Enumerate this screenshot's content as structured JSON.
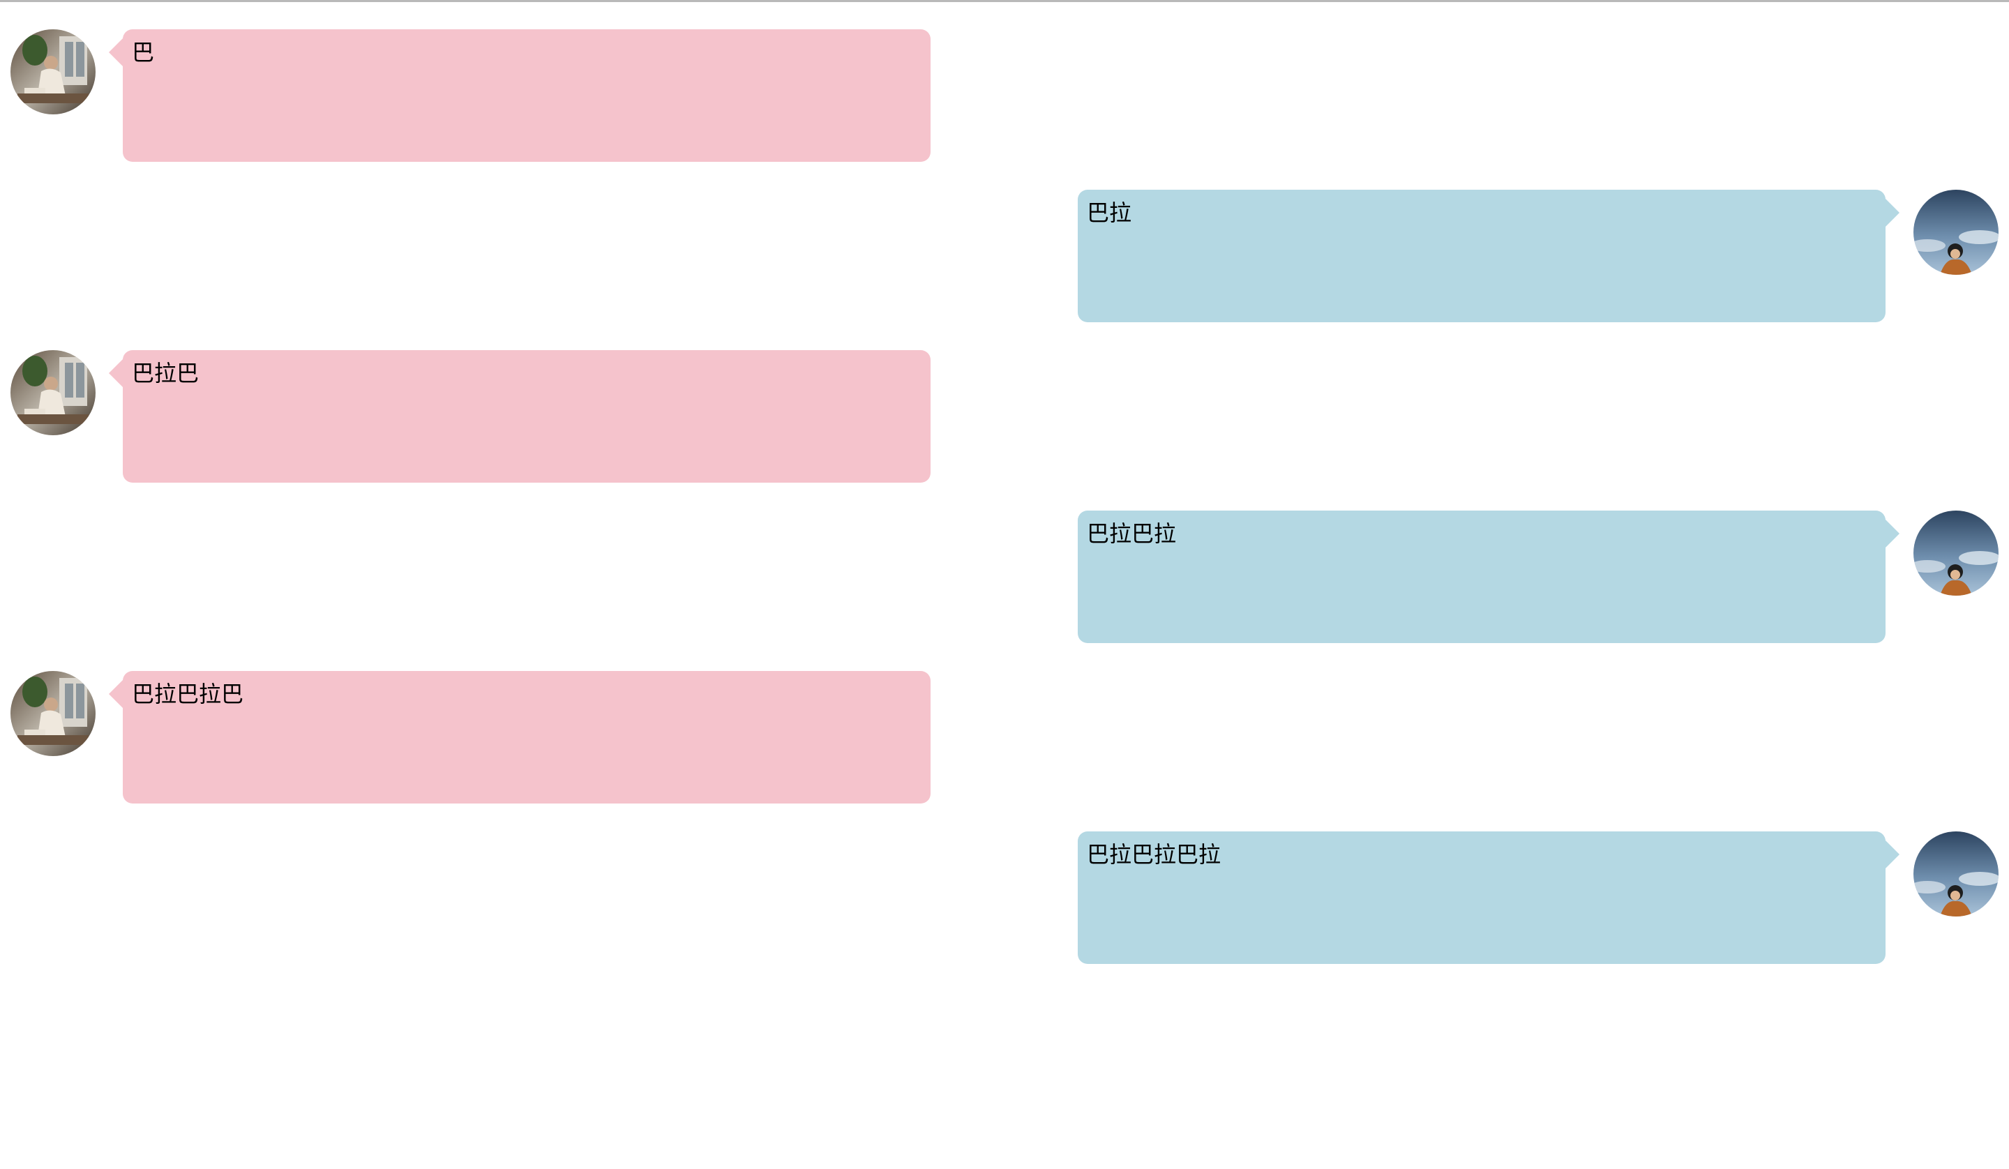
{
  "colors": {
    "received_bubble": "#f5c3cc",
    "sent_bubble": "#b4d8e3",
    "background": "#ffffff"
  },
  "icons": {
    "received_avatar": "woman-photo-avatar",
    "sent_avatar": "sky-person-avatar"
  },
  "messages": [
    {
      "side": "left",
      "text": "巴"
    },
    {
      "side": "right",
      "text": "巴拉"
    },
    {
      "side": "left",
      "text": "巴拉巴"
    },
    {
      "side": "right",
      "text": "巴拉巴拉"
    },
    {
      "side": "left",
      "text": "巴拉巴拉巴"
    },
    {
      "side": "right",
      "text": "巴拉巴拉巴拉"
    }
  ]
}
